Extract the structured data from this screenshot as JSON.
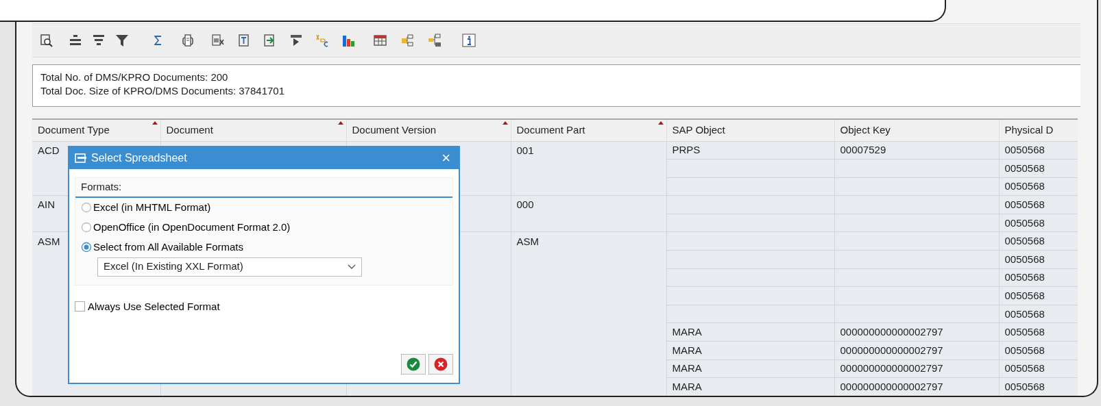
{
  "summary": {
    "lines": [
      "Total No. of DMS/KPRO Documents: 200",
      "Total Doc. Size of KPRO/DMS Documents: 37841701"
    ]
  },
  "table": {
    "columns": [
      {
        "label": "Document Type",
        "sort_marker": true
      },
      {
        "label": "Document",
        "sort_marker": true
      },
      {
        "label": "Document Version",
        "sort_marker": true
      },
      {
        "label": "Document Part",
        "sort_marker": true
      },
      {
        "label": "SAP Object",
        "sort_marker": false
      },
      {
        "label": "Object Key",
        "sort_marker": false
      },
      {
        "label": "Physical D",
        "sort_marker": false
      }
    ],
    "rows": [
      {
        "document_type": "ACD",
        "document_part": "001",
        "sap_object": "PRPS",
        "object_key": "00007529",
        "physical": "0050568"
      },
      {
        "physical": "0050568"
      },
      {
        "physical": "0050568"
      },
      {
        "document_type": "AIN",
        "document_part": "000",
        "physical": "0050568"
      },
      {
        "physical": "0050568"
      },
      {
        "document_type": "ASM",
        "document_part": "ASM",
        "physical": "0050568"
      },
      {
        "physical": "0050568"
      },
      {
        "physical": "0050568"
      },
      {
        "physical": "0050568"
      },
      {
        "physical": "0050568"
      },
      {
        "sap_object": "MARA",
        "object_key": "000000000000002797",
        "physical": "0050568"
      },
      {
        "sap_object": "MARA",
        "object_key": "000000000000002797",
        "physical": "0050568"
      },
      {
        "sap_object": "MARA",
        "object_key": "000000000000002797",
        "physical": "0050568"
      },
      {
        "sap_object": "MARA",
        "object_key": "000000000000002797",
        "physical": "0050568"
      }
    ]
  },
  "dialog": {
    "title": "Select Spreadsheet",
    "close": "×",
    "group_label": "Formats:",
    "options": [
      {
        "label": "Excel (in MHTML Format)",
        "selected": false
      },
      {
        "label": "OpenOffice (in OpenDocument Format 2.0)",
        "selected": false
      },
      {
        "label": "Select from All Available Formats",
        "selected": true
      }
    ],
    "format_select": {
      "value": "Excel (In Existing XXL Format)"
    },
    "always_use": {
      "label": "Always Use Selected Format",
      "checked": false
    }
  }
}
